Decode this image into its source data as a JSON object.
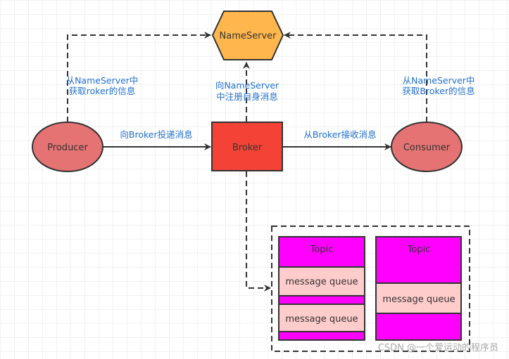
{
  "nodes": {
    "nameserver": "NameServer",
    "producer": "Producer",
    "broker": "Broker",
    "consumer": "Consumer"
  },
  "edges": {
    "producer_to_nameserver": [
      "从NameServer中",
      "获取roker的信息"
    ],
    "broker_to_nameserver": [
      "向NameServer",
      "中注册自身消息"
    ],
    "consumer_to_nameserver": [
      "从NameServer中",
      "获取Broker的信息"
    ],
    "producer_to_broker": "向Broker投递消息",
    "broker_to_consumer": "从Broker接收消息"
  },
  "topics": [
    {
      "title": "Topic",
      "queues": [
        "message queue",
        "message queue"
      ]
    },
    {
      "title": "Topic",
      "queues": [
        "message queue"
      ]
    }
  ],
  "watermark": "CSDN @一个爱运动的程序员",
  "colors": {
    "nameserver": "#FFB74D",
    "producer": "#E57373",
    "broker": "#F44336",
    "consumer": "#E57373",
    "topic": "#FF00FF",
    "queue": "#FFCCCC",
    "label": "#1F6FCF"
  }
}
